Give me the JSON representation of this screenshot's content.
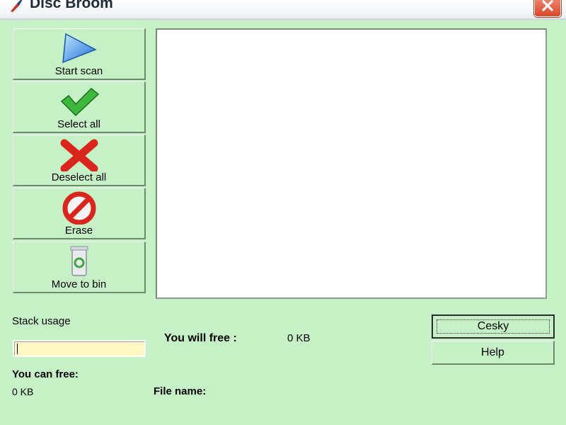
{
  "window": {
    "title": "Disc Broom",
    "icon": "broom-icon",
    "close_icon": "close-icon"
  },
  "toolbar": {
    "items": [
      {
        "label": "Start scan",
        "icon": "play-triangle-icon"
      },
      {
        "label": "Select all",
        "icon": "checkmark-icon"
      },
      {
        "label": "Deselect all",
        "icon": "red-x-icon"
      },
      {
        "label": "Erase",
        "icon": "prohibited-icon"
      },
      {
        "label": "Move to bin",
        "icon": "recycle-bin-icon"
      }
    ]
  },
  "stats": {
    "stack_usage_label": "Stack usage",
    "you_can_free_label": "You can free:",
    "you_can_free_value": "0 KB",
    "you_will_free_label": "You will free :",
    "you_will_free_value": "0 KB",
    "file_name_label": "File name:"
  },
  "buttons": {
    "language_label": "Cesky",
    "help_label": "Help"
  },
  "colors": {
    "background": "#c6f0c6",
    "stack_bar": "#fff8c4"
  }
}
